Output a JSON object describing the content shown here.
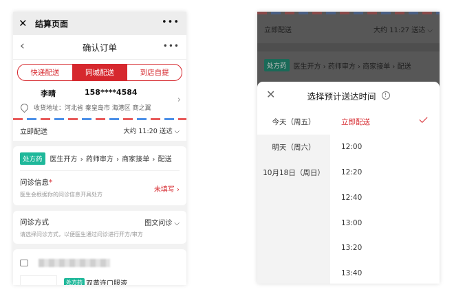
{
  "left": {
    "wx_bar": {
      "close_icon": "close-icon",
      "title": "结算页面",
      "more": "•••"
    },
    "header": {
      "back_icon": "chevron-left-icon",
      "title": "确认订单",
      "more": "•••"
    },
    "delivery_tabs": [
      {
        "label": "快递配送",
        "active": false
      },
      {
        "label": "同城配送",
        "active": true
      },
      {
        "label": "到店自提",
        "active": false
      }
    ],
    "address": {
      "name": "李晴",
      "phone": "158****4584",
      "label": "收货地址：",
      "detail": "河北省 秦皇岛市 海港区 商之翼"
    },
    "delivery": {
      "label": "立即配送",
      "value": "大约 11:20 送达"
    },
    "rx": {
      "badge": "处方药",
      "steps": [
        "医生开方",
        "药师审方",
        "商家接单",
        "配送"
      ]
    },
    "consult_info": {
      "label": "问诊信息",
      "required_mark": "*",
      "sub": "医生会根据你的问诊信息开具处方",
      "status": "未填写"
    },
    "consult_method": {
      "label": "问诊方式",
      "sub": "请选择问诊方式，以便医生通过问诊进行开方/审方",
      "value": "图文问诊"
    },
    "product": {
      "badge": "处方药",
      "name": "双黄连口服液"
    }
  },
  "right": {
    "delivery": {
      "label": "立即配送",
      "value": "大约 11:27 送达"
    },
    "rx": {
      "badge": "处方药",
      "steps": [
        "医生开方",
        "药师审方",
        "商家接单",
        "配送"
      ]
    },
    "sheet": {
      "title": "选择预计送达时间",
      "info_icon": "info-icon",
      "days": [
        {
          "label": "今天（周五）",
          "active": true
        },
        {
          "label": "明天（周六）",
          "active": false
        },
        {
          "label": "10月18日（周日）",
          "active": false
        }
      ],
      "times": [
        {
          "label": "立即配送",
          "selected": true
        },
        {
          "label": "12:00",
          "selected": false
        },
        {
          "label": "12:20",
          "selected": false
        },
        {
          "label": "12:40",
          "selected": false
        },
        {
          "label": "13:00",
          "selected": false
        },
        {
          "label": "13:20",
          "selected": false
        },
        {
          "label": "13:40",
          "selected": false
        }
      ]
    }
  },
  "colors": {
    "accent": "#d6282e",
    "rx_badge": "#1fb89a",
    "overlay": "#575757"
  }
}
